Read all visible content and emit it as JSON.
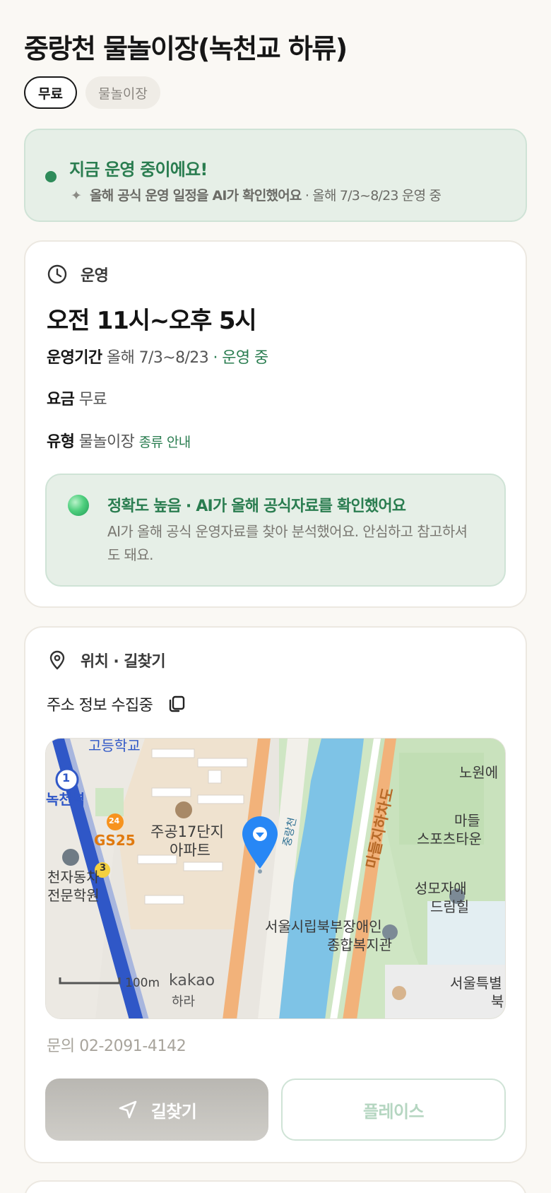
{
  "header": {
    "title": "중랑천 물놀이장(녹천교 하류)",
    "chips": [
      "무료",
      "물놀이장"
    ]
  },
  "status": {
    "headline": "지금 운영 중이에요!",
    "sparkle_icon": "sparkle-icon",
    "sub_bold": "올해 공식 운영 일정을 AI가 확인했어요",
    "sub_rest": " · 올해 7/3~8/23 운영 중",
    "dot_color": "#2e8b5a"
  },
  "operation": {
    "section_label": "운영",
    "icon": "clock-icon",
    "hours": "오전 11시~오후 5시",
    "period_label": "운영기간",
    "period_value": "올해 7/3~8/23",
    "period_status": " · 운영 중",
    "fee_label": "요금",
    "fee_value": "무료",
    "type_label": "유형",
    "type_value": "물놀이장",
    "type_link": "종류 안내"
  },
  "accuracy": {
    "heading": "정확도 높음 · AI가 올해 공식자료를 확인했어요",
    "body": "AI가 올해 공식 운영자료를 찾아 분석했어요. 안심하고 참고하셔도 돼요."
  },
  "location": {
    "section_label": "위치 · 길찾기",
    "icon": "map-pin-icon",
    "address": "주소 정보 수집중",
    "copy_icon": "copy-icon",
    "map_labels": {
      "school": "고등학교",
      "station_num": "1",
      "station": "녹천역",
      "gs_badge": "24",
      "gs": "GS25",
      "apt1": "주공17단지",
      "apt2": "아파트",
      "stream": "중랑천",
      "expressway": "마들지하차도",
      "noone": "노원에",
      "madeul1": "마들",
      "madeul2": "스포츠타운",
      "seongmo1": "성모자애",
      "seongmo2": "드림힐",
      "welfare1": "서울시립북부장애인",
      "welfare2": "종합복지관",
      "seoul1": "서울특별",
      "seoul2": "북",
      "school2a": "천자동차",
      "school2b": "전문학원",
      "bus": "3",
      "scale": "100m",
      "kakao": "kakao",
      "bottom": "하라"
    },
    "phone": "문의 02-2091-4142",
    "nav_button": "길찾기",
    "nav_icon": "navigation-arrow-icon",
    "place_button": "플레이스"
  }
}
